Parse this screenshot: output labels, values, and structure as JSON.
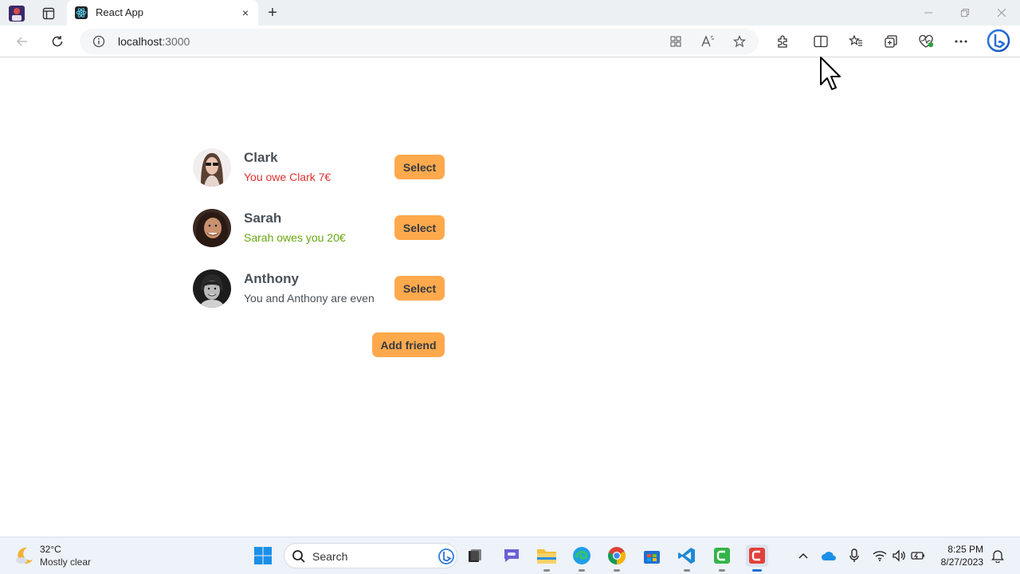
{
  "browser": {
    "tab": {
      "title": "React App",
      "close_glyph": "×"
    },
    "new_tab_glyph": "+",
    "url": {
      "host": "localhost",
      "port": ":3000"
    },
    "icons": [
      "profile-icon",
      "workspaces-icon",
      "react-favicon",
      "back-icon",
      "refresh-icon",
      "info-icon",
      "apps-icon",
      "read-aloud-icon",
      "favorite-star-icon",
      "extensions-icon",
      "split-screen-icon",
      "favorites-icon",
      "collections-icon",
      "browser-essentials-icon",
      "more-icon",
      "bing-icon"
    ]
  },
  "friends": [
    {
      "name": "Clark",
      "status": "You owe Clark 7€",
      "status_color": "#e03131",
      "button": "Select"
    },
    {
      "name": "Sarah",
      "status": "Sarah owes you 20€",
      "status_color": "#66a80f",
      "button": "Select"
    },
    {
      "name": "Anthony",
      "status": "You and Anthony are even",
      "status_color": "#495057",
      "button": "Select"
    }
  ],
  "add_friend_label": "Add friend",
  "colors": {
    "accent": "#ffa94d",
    "owe": "#e03131",
    "owed": "#66a80f",
    "even": "#495057"
  },
  "taskbar": {
    "weather": {
      "temp": "32°C",
      "desc": "Mostly clear"
    },
    "search_placeholder": "Search",
    "clock": {
      "time": "8:25 PM",
      "date": "8/27/2023"
    },
    "apps": [
      "windows-start-icon",
      "search-icon",
      "task-view-icon",
      "teams-chat-icon",
      "file-explorer-icon",
      "edge-icon",
      "chrome-icon",
      "store-icon",
      "vscode-icon",
      "app-green-icon",
      "app-red-icon"
    ],
    "tray": [
      "chevron-up-icon",
      "onedrive-icon",
      "microphone-icon",
      "wifi-icon",
      "volume-icon",
      "battery-icon",
      "notification-icon"
    ]
  }
}
